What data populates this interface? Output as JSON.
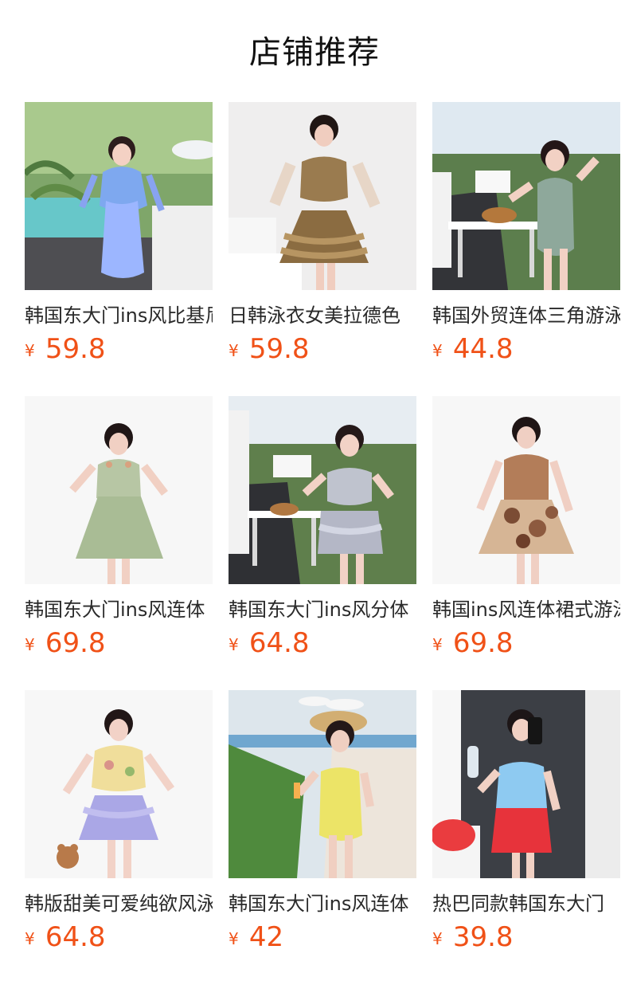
{
  "page": {
    "title": "店铺推荐"
  },
  "colors": {
    "price": "#f05117",
    "title": "#111111",
    "name": "#2a2a2a"
  },
  "currency_symbol": "¥",
  "products": [
    {
      "name": "韩国东大门ins风比基尼",
      "price": "59.8",
      "image_icon": "photo-swimsuit-blue-pool"
    },
    {
      "name": "日韩泳衣女美拉德色",
      "price": "59.8",
      "image_icon": "photo-swimsuit-brown-studio"
    },
    {
      "name": "韩国外贸连体三角游泳衣",
      "price": "44.8",
      "image_icon": "photo-swimsuit-mint-garden"
    },
    {
      "name": "韩国东大门ins风连体",
      "price": "69.8",
      "image_icon": "photo-swimdress-sage-studio"
    },
    {
      "name": "韩国东大门ins风分体",
      "price": "64.8",
      "image_icon": "photo-swimsuit-gray-garden"
    },
    {
      "name": "韩国ins风连体裙式游泳衣",
      "price": "69.8",
      "image_icon": "photo-swimdress-leopard-studio"
    },
    {
      "name": "韩版甜美可爱纯欲风泳衣",
      "price": "64.8",
      "image_icon": "photo-swimsuit-floral-lavender"
    },
    {
      "name": "韩国东大门ins风连体",
      "price": "42",
      "image_icon": "photo-swimsuit-yellow-beach"
    },
    {
      "name": "热巴同款韩国东大门",
      "price": "39.8",
      "image_icon": "photo-swimsuit-gingham-red"
    }
  ]
}
